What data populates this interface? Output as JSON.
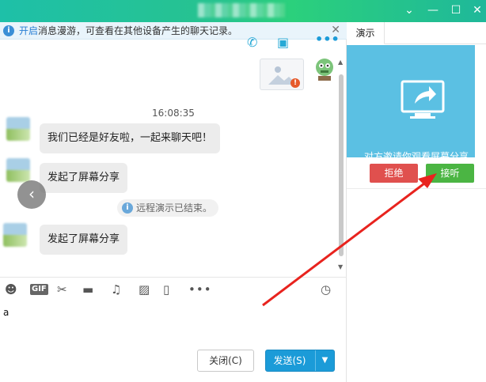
{
  "window": {
    "minimize_glyph": "—",
    "maximize_glyph": "☐",
    "close_glyph": "✕",
    "collapse_glyph": "⌄"
  },
  "notice": {
    "link_text": "开启",
    "text": "消息漫游，可查看在其他设备产生的聊天记录。",
    "close_glyph": "✕"
  },
  "chat": {
    "timestamp": "16:08:35",
    "messages": [
      {
        "text": "我们已经是好友啦，一起来聊天吧！"
      },
      {
        "text": "发起了屏幕分享"
      },
      {
        "text": "发起了屏幕分享"
      }
    ],
    "system_message": "远程演示已结束。",
    "input_value": "a"
  },
  "buttons": {
    "close_label": "关闭(C)",
    "send_label": "发送(S)"
  },
  "right_panel": {
    "tab_label": "演示",
    "share_prompt": "对方邀请你观看屏幕分享",
    "reject_label": "拒绝",
    "accept_label": "接听"
  },
  "colors": {
    "accent_blue": "#1b9bd8",
    "share_card": "#5bc0e3",
    "reject_red": "#e0504e",
    "accept_green": "#4bb543",
    "annotation_red": "#e8231e"
  },
  "icons": {
    "toolbar": [
      "emoji-icon",
      "gif-icon",
      "scissors-icon",
      "folder-icon",
      "music-icon",
      "image-icon",
      "shake-icon",
      "more-icon",
      "history-clock-icon"
    ],
    "top": [
      "phone-icon",
      "video-call-icon",
      "more-dots-icon"
    ]
  }
}
